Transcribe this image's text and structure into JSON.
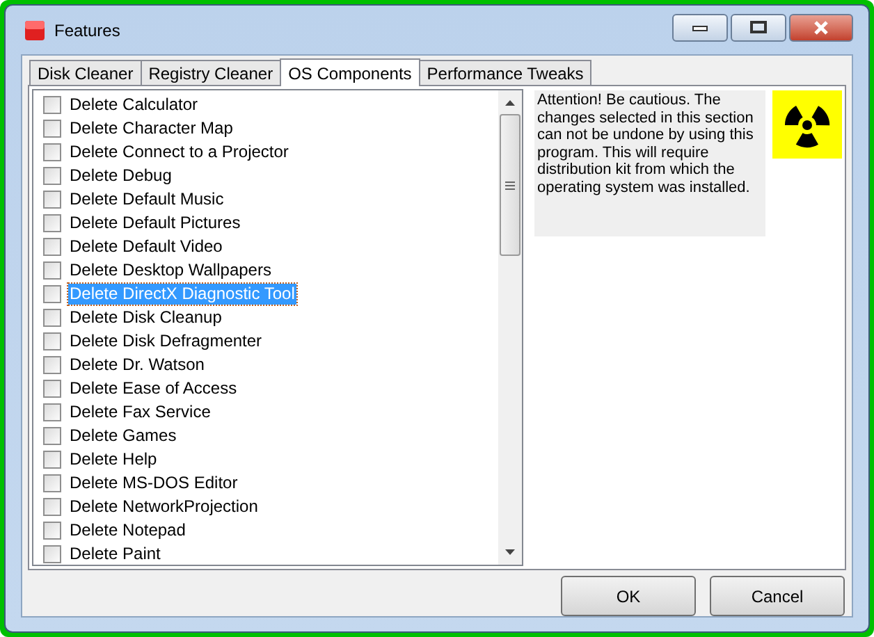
{
  "window": {
    "title": "Features"
  },
  "tabs": [
    {
      "label": "Disk Cleaner",
      "selected": false
    },
    {
      "label": "Registry Cleaner",
      "selected": false
    },
    {
      "label": "OS Components",
      "selected": true
    },
    {
      "label": "Performance Tweaks",
      "selected": false
    }
  ],
  "components": [
    {
      "label": "Delete Calculator",
      "checked": false,
      "selected": false
    },
    {
      "label": "Delete Character Map",
      "checked": false,
      "selected": false
    },
    {
      "label": "Delete Connect to a Projector",
      "checked": false,
      "selected": false
    },
    {
      "label": "Delete Debug",
      "checked": false,
      "selected": false
    },
    {
      "label": "Delete Default Music",
      "checked": false,
      "selected": false
    },
    {
      "label": "Delete Default Pictures",
      "checked": false,
      "selected": false
    },
    {
      "label": "Delete Default Video",
      "checked": false,
      "selected": false
    },
    {
      "label": "Delete Desktop Wallpapers",
      "checked": false,
      "selected": false
    },
    {
      "label": "Delete DirectX Diagnostic Tool",
      "checked": false,
      "selected": true
    },
    {
      "label": "Delete Disk Cleanup",
      "checked": false,
      "selected": false
    },
    {
      "label": "Delete Disk Defragmenter",
      "checked": false,
      "selected": false
    },
    {
      "label": "Delete Dr. Watson",
      "checked": false,
      "selected": false
    },
    {
      "label": "Delete Ease of Access",
      "checked": false,
      "selected": false
    },
    {
      "label": "Delete Fax Service",
      "checked": false,
      "selected": false
    },
    {
      "label": "Delete Games",
      "checked": false,
      "selected": false
    },
    {
      "label": "Delete Help",
      "checked": false,
      "selected": false
    },
    {
      "label": "Delete MS-DOS Editor",
      "checked": false,
      "selected": false
    },
    {
      "label": "Delete NetworkProjection",
      "checked": false,
      "selected": false
    },
    {
      "label": "Delete Notepad",
      "checked": false,
      "selected": false
    },
    {
      "label": "Delete Paint",
      "checked": false,
      "selected": false
    }
  ],
  "notice": "Attention! Be cautious. The changes selected in this section can not be undone by using this program. This will require distribution kit from which the operating system was installed.",
  "buttons": [
    "OK",
    "Cancel"
  ]
}
